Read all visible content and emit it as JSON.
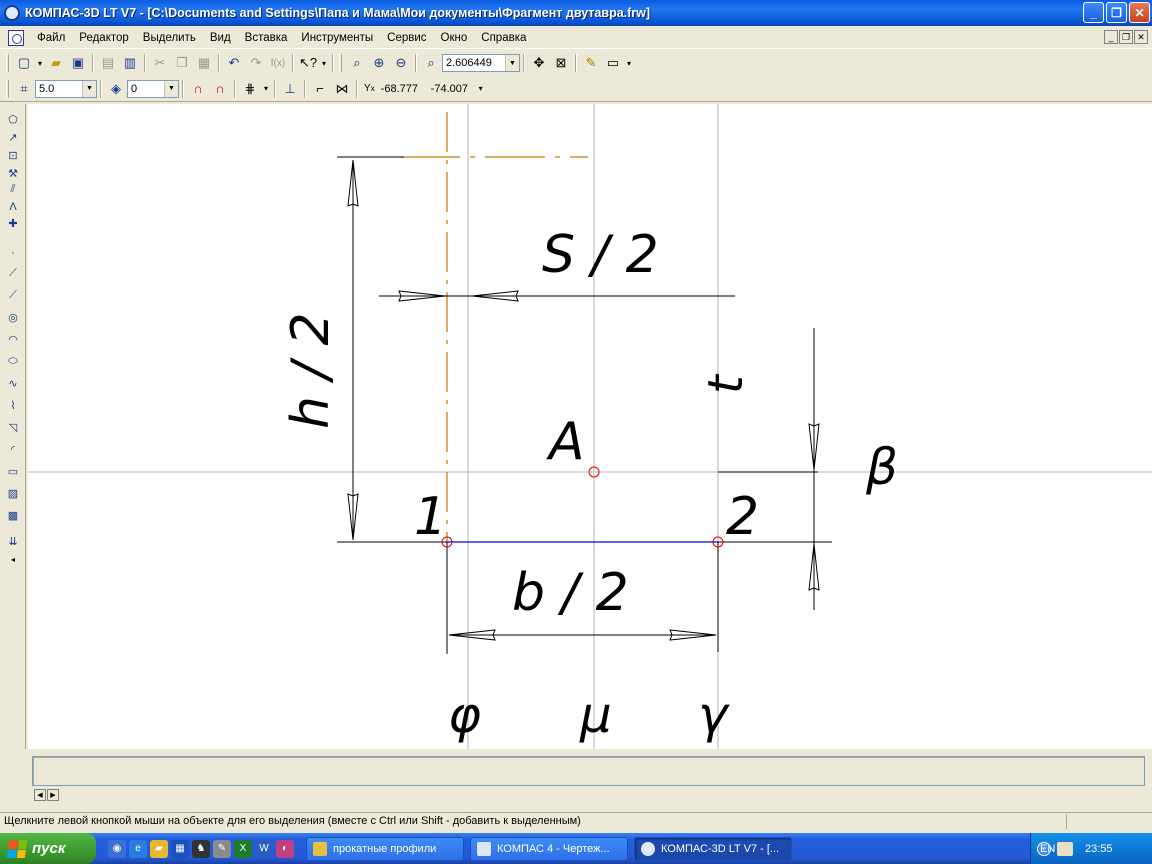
{
  "window": {
    "title": "КОМПАС-3D LT V7 - [C:\\Documents and Settings\\Папа и Мама\\Мои документы\\Фрагмент двутавра.frw]",
    "buttons": [
      "_",
      "❐",
      "✕"
    ]
  },
  "menu": {
    "items": [
      "Файл",
      "Редактор",
      "Выделить",
      "Вид",
      "Вставка",
      "Инструменты",
      "Сервис",
      "Окно",
      "Справка"
    ],
    "mdi_buttons": [
      "_",
      "❐",
      "✕"
    ]
  },
  "toolbar1": {
    "zoom_value": "2.606449"
  },
  "toolbar2": {
    "step_value": "5.0",
    "layer_value": "0",
    "coord_x": "-68.777",
    "coord_y": "-74.007",
    "coord_label": "Y",
    "coord_sub": "x"
  },
  "drawing": {
    "labels": {
      "s2": "S / 2",
      "h2": "h / 2",
      "t": "t",
      "a": "A",
      "beta": "β",
      "p1": "1",
      "p2": "2",
      "b2": "b / 2",
      "phi": "φ",
      "mu": "μ",
      "gamma": "γ"
    },
    "colors": {
      "axis_line": "#c87800",
      "edge_line": "#0000e0",
      "point": "#e00000",
      "aux_line": "#b0b0b0"
    }
  },
  "statusbar": {
    "hint": "Щелкните левой кнопкой мыши на объекте для его выделения (вместе с Ctrl или Shift - добавить к выделенным)"
  },
  "taskbar": {
    "start": "пуск",
    "tasks": [
      {
        "label": "прокатные профили",
        "icon": "folder-icon"
      },
      {
        "label": "КОМПАС 4 - Чертеж...",
        "icon": "document-icon"
      },
      {
        "label": "КОМПАС-3D LT V7 - [...",
        "icon": "kompas-icon"
      }
    ],
    "lang": "EN",
    "clock": "23:55"
  }
}
